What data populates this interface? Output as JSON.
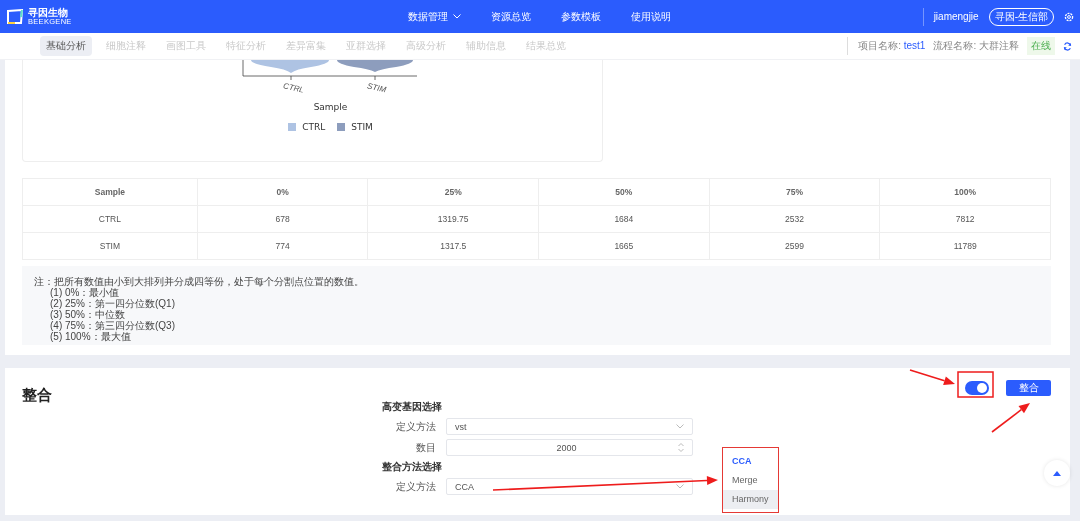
{
  "header": {
    "logo": {
      "name": "寻因生物",
      "sub": "BEEKGENE"
    },
    "nav": [
      {
        "label": "数据管理",
        "dropdown": true
      },
      {
        "label": "资源总览",
        "dropdown": false
      },
      {
        "label": "参数模板",
        "dropdown": false
      },
      {
        "label": "使用说明",
        "dropdown": false
      }
    ],
    "user": "jiamengjie",
    "org": "寻因-生信部"
  },
  "subnav": {
    "tabs": [
      {
        "label": "基础分析",
        "selected": true
      },
      {
        "label": "细胞注释",
        "selected": false
      },
      {
        "label": "画图工具",
        "selected": false
      },
      {
        "label": "特征分析",
        "selected": false
      },
      {
        "label": "差异富集",
        "selected": false
      },
      {
        "label": "亚群选择",
        "selected": false
      },
      {
        "label": "高级分析",
        "selected": false
      },
      {
        "label": "辅助信息",
        "selected": false
      },
      {
        "label": "结果总览",
        "selected": false
      }
    ],
    "project_label": "项目名称:",
    "project": "test1",
    "flow_label": "流程名称:",
    "flow": "大群注释",
    "status": "在线"
  },
  "chart": {
    "x_labels": [
      "CTRL",
      "STIM"
    ],
    "axis_title": "Sample",
    "legend": [
      {
        "label": "CTRL",
        "color": "#aec3e3"
      },
      {
        "label": "STIM",
        "color": "#8d9dbd"
      }
    ]
  },
  "table": {
    "columns": [
      "Sample",
      "0%",
      "25%",
      "50%",
      "75%",
      "100%"
    ],
    "rows": [
      [
        "CTRL",
        "678",
        "1319.75",
        "1684",
        "2532",
        "7812"
      ],
      [
        "STIM",
        "774",
        "1317.5",
        "1665",
        "2599",
        "11789"
      ]
    ]
  },
  "note": [
    "注：把所有数值由小到大排列并分成四等份，处于每个分割点位置的数值。",
    "(1) 0%：最小值",
    "(2) 25%：第一四分位数(Q1)",
    "(3) 50%：中位数",
    "(4) 75%：第三四分位数(Q3)",
    "(5) 100%：最大值"
  ],
  "integrate": {
    "title": "整合",
    "toggle_on": true,
    "button": "整合",
    "groups": [
      {
        "title": "高变基因选择",
        "fields": [
          {
            "kind": "select",
            "label": "定义方法",
            "value": "vst"
          },
          {
            "kind": "number",
            "label": "数目",
            "value": "2000"
          }
        ]
      },
      {
        "title": "整合方法选择",
        "fields": [
          {
            "kind": "select",
            "label": "定义方法",
            "value": "CCA"
          }
        ]
      }
    ],
    "options": [
      {
        "label": "CCA",
        "selected": true,
        "hovered": false
      },
      {
        "label": "Merge",
        "selected": false,
        "hovered": false
      },
      {
        "label": "Harmony",
        "selected": false,
        "hovered": true
      }
    ]
  }
}
